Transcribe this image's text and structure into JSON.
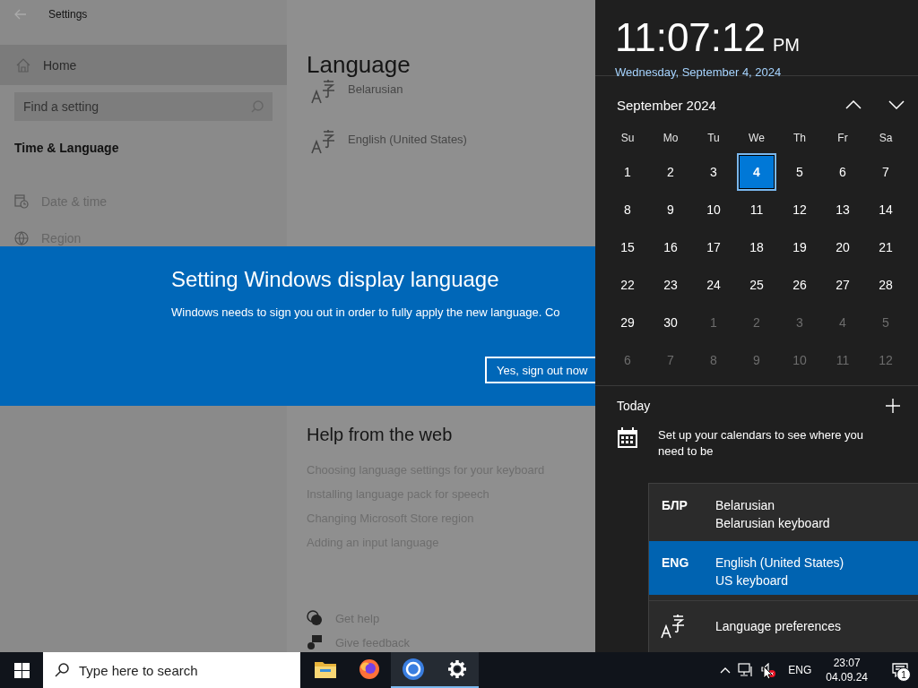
{
  "settings": {
    "title": "Settings",
    "home": "Home",
    "search": {
      "placeholder": "Find a setting"
    },
    "section": "Time & Language",
    "nav": [
      {
        "label": "Date & time",
        "kind": "clock"
      },
      {
        "label": "Region",
        "kind": "globe"
      }
    ],
    "page_title": "Language",
    "languages": [
      "Belarusian",
      "English (United States)"
    ],
    "help": {
      "title": "Help from the web",
      "links": [
        "Choosing language settings for your keyboard",
        "Installing language pack for speech",
        "Changing Microsoft Store region",
        "Adding an input language"
      ],
      "actions": [
        {
          "label": "Get help",
          "kind": "help"
        },
        {
          "label": "Give feedback",
          "kind": "feedback"
        }
      ]
    }
  },
  "dialog": {
    "title": "Setting Windows display language",
    "message": "Windows needs to sign you out in order to fully apply the new language. Co",
    "button": "Yes, sign out now"
  },
  "clock": {
    "time": "11:07:12",
    "ampm": "PM",
    "date": "Wednesday, September 4, 2024"
  },
  "calendar": {
    "month": "September 2024",
    "weekdays": [
      "Su",
      "Mo",
      "Tu",
      "We",
      "Th",
      "Fr",
      "Sa"
    ],
    "weeks": [
      [
        {
          "day": "1",
          "other_month": false,
          "selected": false
        },
        {
          "day": "2",
          "other_month": false,
          "selected": false
        },
        {
          "day": "3",
          "other_month": false,
          "selected": false
        },
        {
          "day": "4",
          "other_month": false,
          "selected": true
        },
        {
          "day": "5",
          "other_month": false,
          "selected": false
        },
        {
          "day": "6",
          "other_month": false,
          "selected": false
        },
        {
          "day": "7",
          "other_month": false,
          "selected": false
        }
      ],
      [
        {
          "day": "8",
          "other_month": false,
          "selected": false
        },
        {
          "day": "9",
          "other_month": false,
          "selected": false
        },
        {
          "day": "10",
          "other_month": false,
          "selected": false
        },
        {
          "day": "11",
          "other_month": false,
          "selected": false
        },
        {
          "day": "12",
          "other_month": false,
          "selected": false
        },
        {
          "day": "13",
          "other_month": false,
          "selected": false
        },
        {
          "day": "14",
          "other_month": false,
          "selected": false
        }
      ],
      [
        {
          "day": "15",
          "other_month": false,
          "selected": false
        },
        {
          "day": "16",
          "other_month": false,
          "selected": false
        },
        {
          "day": "17",
          "other_month": false,
          "selected": false
        },
        {
          "day": "18",
          "other_month": false,
          "selected": false
        },
        {
          "day": "19",
          "other_month": false,
          "selected": false
        },
        {
          "day": "20",
          "other_month": false,
          "selected": false
        },
        {
          "day": "21",
          "other_month": false,
          "selected": false
        }
      ],
      [
        {
          "day": "22",
          "other_month": false,
          "selected": false
        },
        {
          "day": "23",
          "other_month": false,
          "selected": false
        },
        {
          "day": "24",
          "other_month": false,
          "selected": false
        },
        {
          "day": "25",
          "other_month": false,
          "selected": false
        },
        {
          "day": "26",
          "other_month": false,
          "selected": false
        },
        {
          "day": "27",
          "other_month": false,
          "selected": false
        },
        {
          "day": "28",
          "other_month": false,
          "selected": false
        }
      ],
      [
        {
          "day": "29",
          "other_month": false,
          "selected": false
        },
        {
          "day": "30",
          "other_month": false,
          "selected": false
        },
        {
          "day": "1",
          "other_month": true,
          "selected": false
        },
        {
          "day": "2",
          "other_month": true,
          "selected": false
        },
        {
          "day": "3",
          "other_month": true,
          "selected": false
        },
        {
          "day": "4",
          "other_month": true,
          "selected": false
        },
        {
          "day": "5",
          "other_month": true,
          "selected": false
        }
      ],
      [
        {
          "day": "6",
          "other_month": true,
          "selected": false
        },
        {
          "day": "7",
          "other_month": true,
          "selected": false
        },
        {
          "day": "8",
          "other_month": true,
          "selected": false
        },
        {
          "day": "9",
          "other_month": true,
          "selected": false
        },
        {
          "day": "10",
          "other_month": true,
          "selected": false
        },
        {
          "day": "11",
          "other_month": true,
          "selected": false
        },
        {
          "day": "12",
          "other_month": true,
          "selected": false
        }
      ]
    ]
  },
  "agenda": {
    "title": "Today",
    "message": "Set up your calendars to see where you need to be"
  },
  "input_languages": [
    {
      "code": "БЛР",
      "name": "Belarusian",
      "keyboard": "Belarusian keyboard",
      "selected": false
    },
    {
      "code": "ENG",
      "name": "English (United States)",
      "keyboard": "US keyboard",
      "selected": true
    }
  ],
  "language_preferences": "Language preferences",
  "taskbar": {
    "search_placeholder": "Type here to search",
    "apps": [
      {
        "kind": "folder",
        "running": false
      },
      {
        "kind": "firefox",
        "running": false
      },
      {
        "kind": "chrome",
        "running": true
      },
      {
        "kind": "settings",
        "running": true
      }
    ],
    "input_indicator": "ENG",
    "time": "23:07",
    "date": "04.09.24",
    "notifications": "1"
  }
}
